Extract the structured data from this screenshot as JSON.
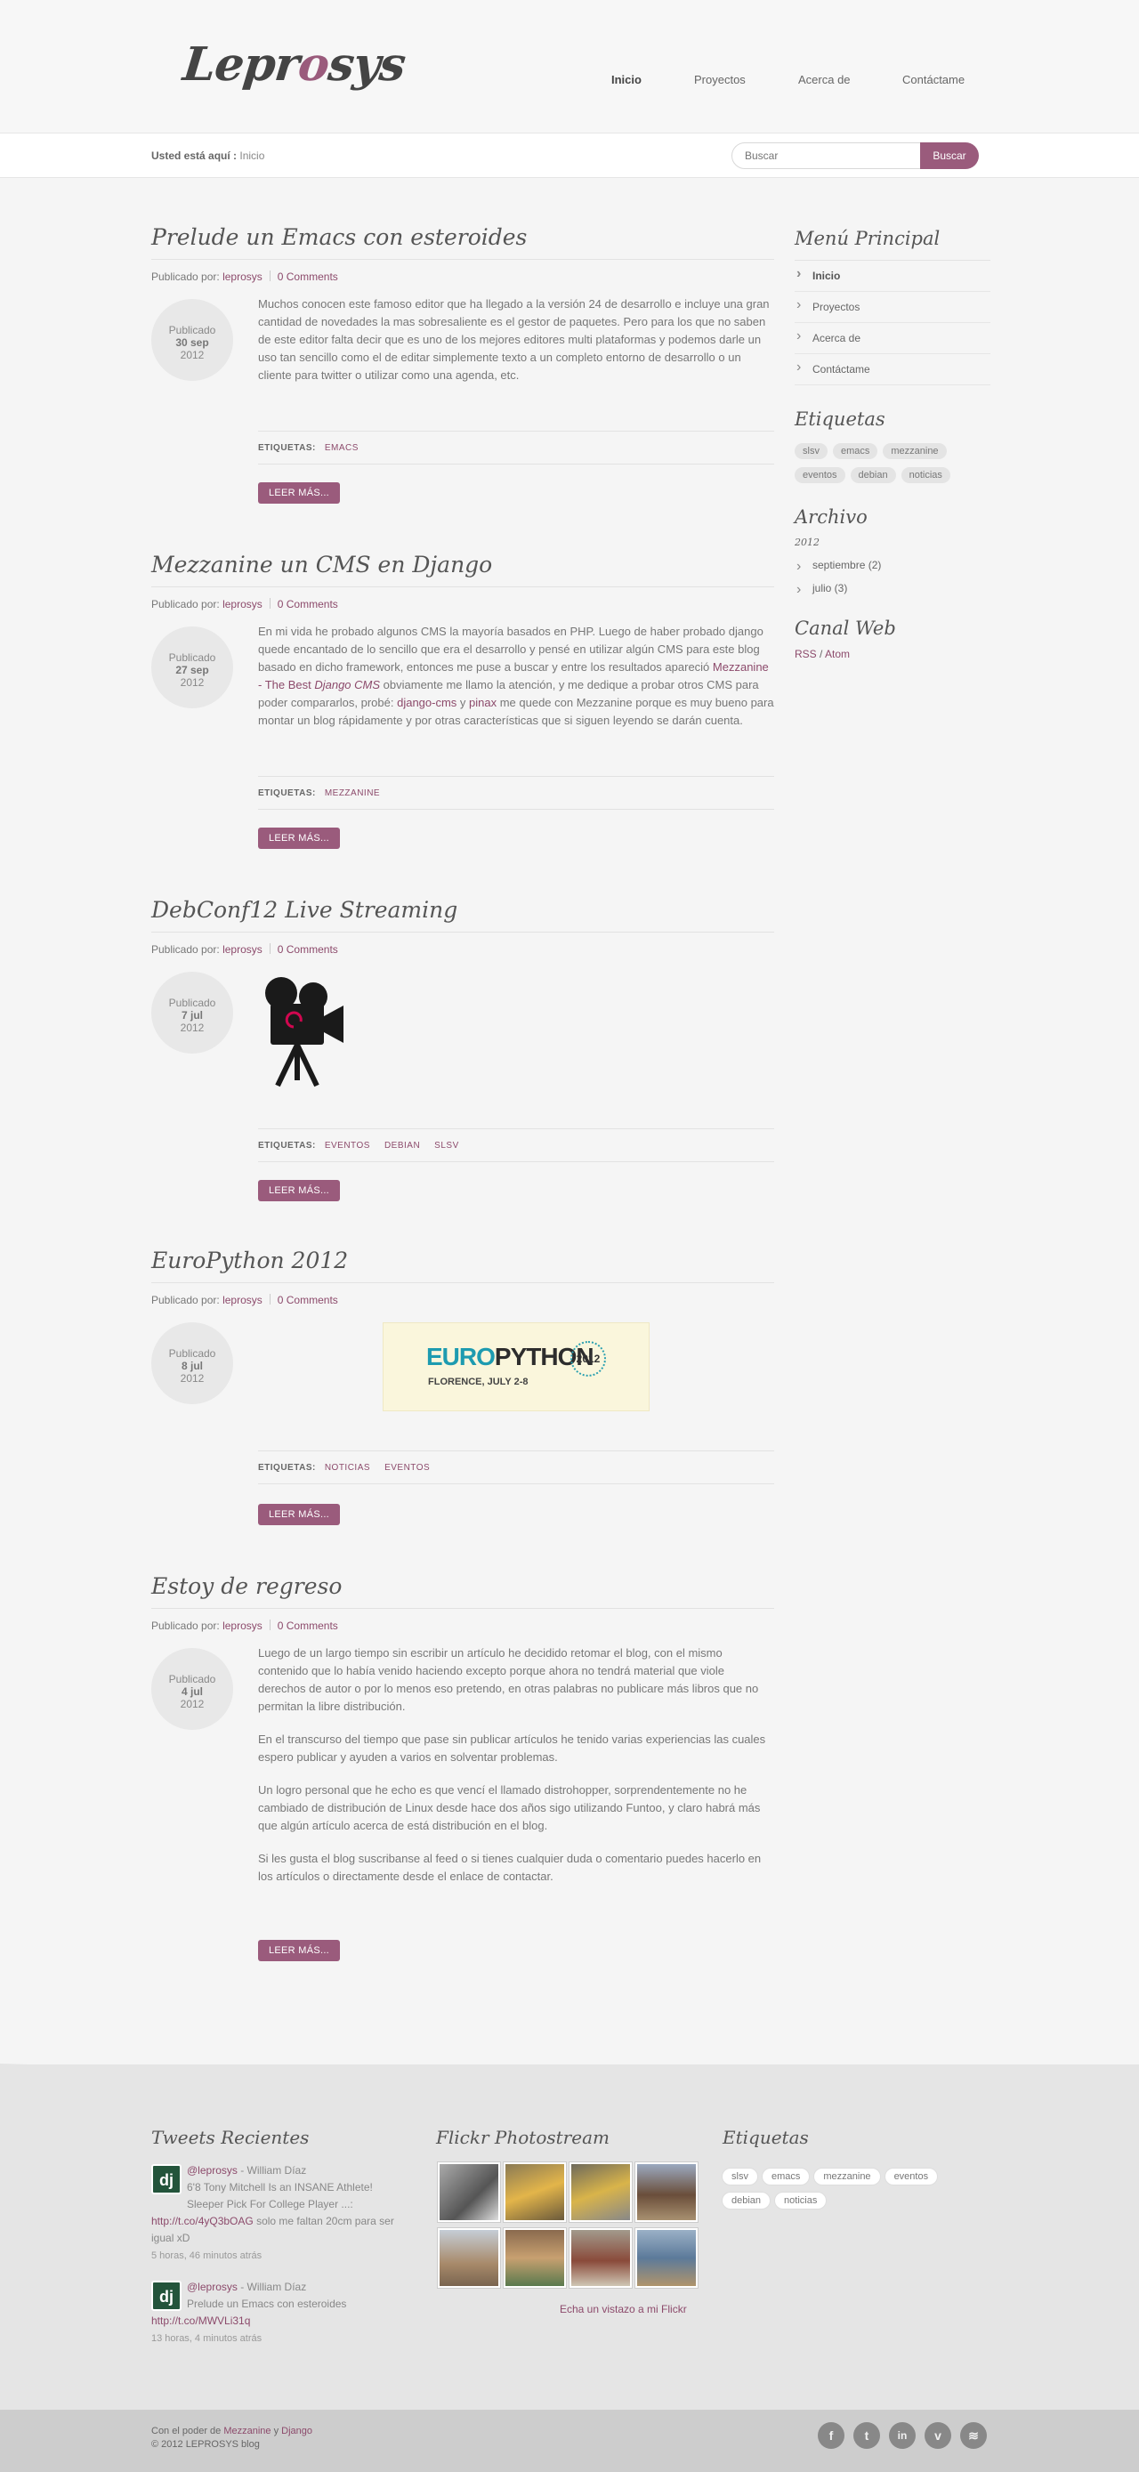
{
  "brand": {
    "logo_pre": "Lepr",
    "logo_o": "o",
    "logo_post": "sys"
  },
  "nav": [
    {
      "label": "Inicio"
    },
    {
      "label": "Proyectos"
    },
    {
      "label": "Acerca de"
    },
    {
      "label": "Contáctame"
    }
  ],
  "breadcrumb": {
    "prefix": "Usted está aquí :",
    "current": "Inicio"
  },
  "search": {
    "placeholder": "Buscar",
    "button": "Buscar"
  },
  "common": {
    "published_by": "Publicado por:",
    "tags_label": "ETIQUETAS:",
    "read_more": "LEER MÁS...",
    "published": "Publicado"
  },
  "posts": [
    {
      "title": "Prelude un Emacs con esteroides",
      "author": "leprosys",
      "comments": "0 Comments",
      "day": "30 sep",
      "year": "2012",
      "paragraphs": [
        "Muchos conocen este famoso editor que ha llegado a la versión 24 de desarrollo e incluye una gran cantidad de novedades la mas sobresaliente es el gestor de paquetes. Pero para los que no saben de este editor falta decir que es uno de los mejores editores multi plataformas y podemos darle un uso tan sencillo como el de editar simplemente texto a un completo entorno de desarrollo o un cliente para twitter o utilizar como una agenda, etc."
      ],
      "tags": [
        "EMACS"
      ]
    },
    {
      "title": "Mezzanine un CMS en Django",
      "author": "leprosys",
      "comments": "0 Comments",
      "day": "27 sep",
      "year": "2012",
      "p_a": "En mi vida he probado algunos CMS la mayoría basados en PHP. Luego de haber probado django quede encantado de lo sencillo que era el desarrollo y pensé en utilizar algún CMS para este blog basado en dicho framework, entonces me puse a buscar y entre los resultados apareció ",
      "link1": "Mezzanine - The Best ",
      "link1_em": "Django CMS",
      "p_b": " obviamente me llamo la atención, y me dedique a probar otros CMS para poder compararlos, probé: ",
      "link2": "django-cms",
      "p_c": " y ",
      "link3": "pinax",
      "p_d": " me quede con Mezzanine porque es muy bueno para montar un blog rápidamente y por otras características que si siguen leyendo se darán cuenta.",
      "tags": [
        "MEZZANINE"
      ]
    },
    {
      "title": "DebConf12 Live Streaming",
      "author": "leprosys",
      "comments": "0 Comments",
      "day": "7 jul",
      "year": "2012",
      "tags": [
        "EVENTOS",
        "DEBIAN",
        "SLSV"
      ]
    },
    {
      "title": "EuroPython 2012",
      "author": "leprosys",
      "comments": "0 Comments",
      "day": "8 jul",
      "year": "2012",
      "banner": {
        "euro": "EURO",
        "python": "PYTHON",
        "year": "2012",
        "city": "FLORENCE, JULY 2-8"
      },
      "tags": [
        "NOTICIAS",
        "EVENTOS"
      ]
    },
    {
      "title": "Estoy de regreso",
      "author": "leprosys",
      "comments": "0 Comments",
      "day": "4 jul",
      "year": "2012",
      "paragraphs": [
        "Luego de un largo tiempo sin escribir un artículo he decidido retomar el blog, con el mismo contenido que lo había venido haciendo excepto porque ahora no tendrá material que viole derechos de autor o por lo menos eso pretendo, en otras palabras no publicare más libros que no permitan la libre distribución.",
        "En el transcurso del tiempo que pase sin publicar artículos he tenido varias experiencias las cuales espero publicar y ayuden a varios en solventar problemas.",
        "Un logro personal que he echo es que vencí el llamado distrohopper, sorprendentemente no he cambiado de distribución de Linux desde hace dos años sigo utilizando Funtoo, y claro habrá más que algún artículo acerca de está distribución en el blog.",
        "Si les gusta el blog suscribanse al feed o si tienes cualquier duda o comentario puedes hacerlo en los artículos o directamente desde el enlace de contactar."
      ]
    }
  ],
  "sidebar": {
    "menu_title": "Menú Principal",
    "menu": [
      "Inicio",
      "Proyectos",
      "Acerca de",
      "Contáctame"
    ],
    "tags_title": "Etiquetas",
    "tags": [
      "slsv",
      "emacs",
      "mezzanine",
      "eventos",
      "debian",
      "noticias"
    ],
    "archive_title": "Archivo",
    "archive_year": "2012",
    "archive": [
      "septiembre (2)",
      "julio (3)"
    ],
    "feed_title": "Canal Web",
    "rss": "RSS",
    "slash": " / ",
    "atom": "Atom"
  },
  "footer": {
    "tweets_title": "Tweets Recientes",
    "tweets": [
      {
        "handle": "@leprosys",
        "name": " - William Díaz",
        "text": "6'8 Tony Mitchell Is an INSANE Athlete! Sleeper Pick For College Player ...:",
        "link": "http://t.co/4yQ3bOAG",
        "tail": " solo me faltan 20cm para ser igual xD",
        "time": "5 horas, 46 minutos atrás"
      },
      {
        "handle": "@leprosys",
        "name": " - William Díaz",
        "text": "Prelude un Emacs con esteroides",
        "link": "http://t.co/MWVLi31q",
        "tail": "",
        "time": "13 horas, 4 minutos atrás"
      }
    ],
    "flickr_title": "Flickr Photostream",
    "flickr_link": "Echa un vistazo a mi Flickr",
    "tags_title": "Etiquetas",
    "tags": [
      "slsv",
      "emacs",
      "mezzanine",
      "eventos",
      "debian",
      "noticias"
    ],
    "powered": "Con el poder de ",
    "mezz": "Mezzanine",
    "y": " y ",
    "django": "Django",
    "copyright": "© 2012 LEPROSYS blog",
    "social": [
      {
        "icon": "facebook-icon",
        "glyph": "f"
      },
      {
        "icon": "twitter-icon",
        "glyph": "t"
      },
      {
        "icon": "linkedin-icon",
        "glyph": "in"
      },
      {
        "icon": "vimeo-icon",
        "glyph": "v"
      },
      {
        "icon": "rss-icon",
        "glyph": "≋"
      }
    ]
  }
}
